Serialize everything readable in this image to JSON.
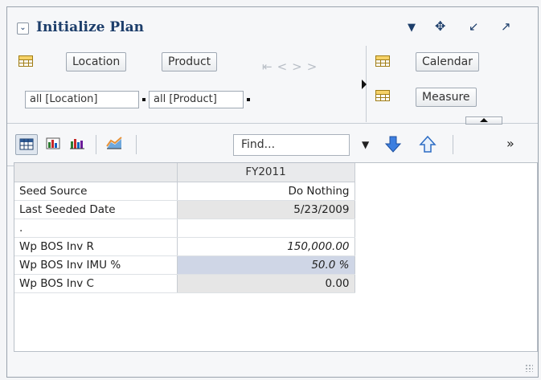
{
  "window": {
    "title": "Initialize Plan"
  },
  "dimensions": {
    "row_buttons": [
      "Location",
      "Product"
    ],
    "row_filters": [
      "all [Location]",
      "all [Product]"
    ],
    "column_buttons": [
      "Calendar",
      "Measure"
    ]
  },
  "toolbar": {
    "find_placeholder": "Find..."
  },
  "table": {
    "column_header": "FY2011",
    "rows": [
      {
        "label": "Seed Source",
        "value": "Do Nothing"
      },
      {
        "label": "Last Seeded Date",
        "value": "5/23/2009"
      },
      {
        "label": ".",
        "value": ""
      },
      {
        "label": "Wp BOS Inv R",
        "value": "150,000.00"
      },
      {
        "label": "Wp BOS Inv IMU %",
        "value": "50.0 %"
      },
      {
        "label": "Wp BOS Inv C",
        "value": "0.00"
      }
    ]
  },
  "icons": [
    "collapse-icon",
    "menu-down-icon",
    "move-icon",
    "minimize-icon",
    "maximize-icon",
    "grid-icon",
    "chart-icon",
    "bar-chart-icon",
    "area-chart-icon",
    "arrow-down-icon",
    "arrow-up-icon",
    "more-icon"
  ],
  "colors": {
    "title": "#1d3e6b",
    "selected_cell": "#cfd6e6",
    "readonly_cell": "#e6e6e6"
  }
}
